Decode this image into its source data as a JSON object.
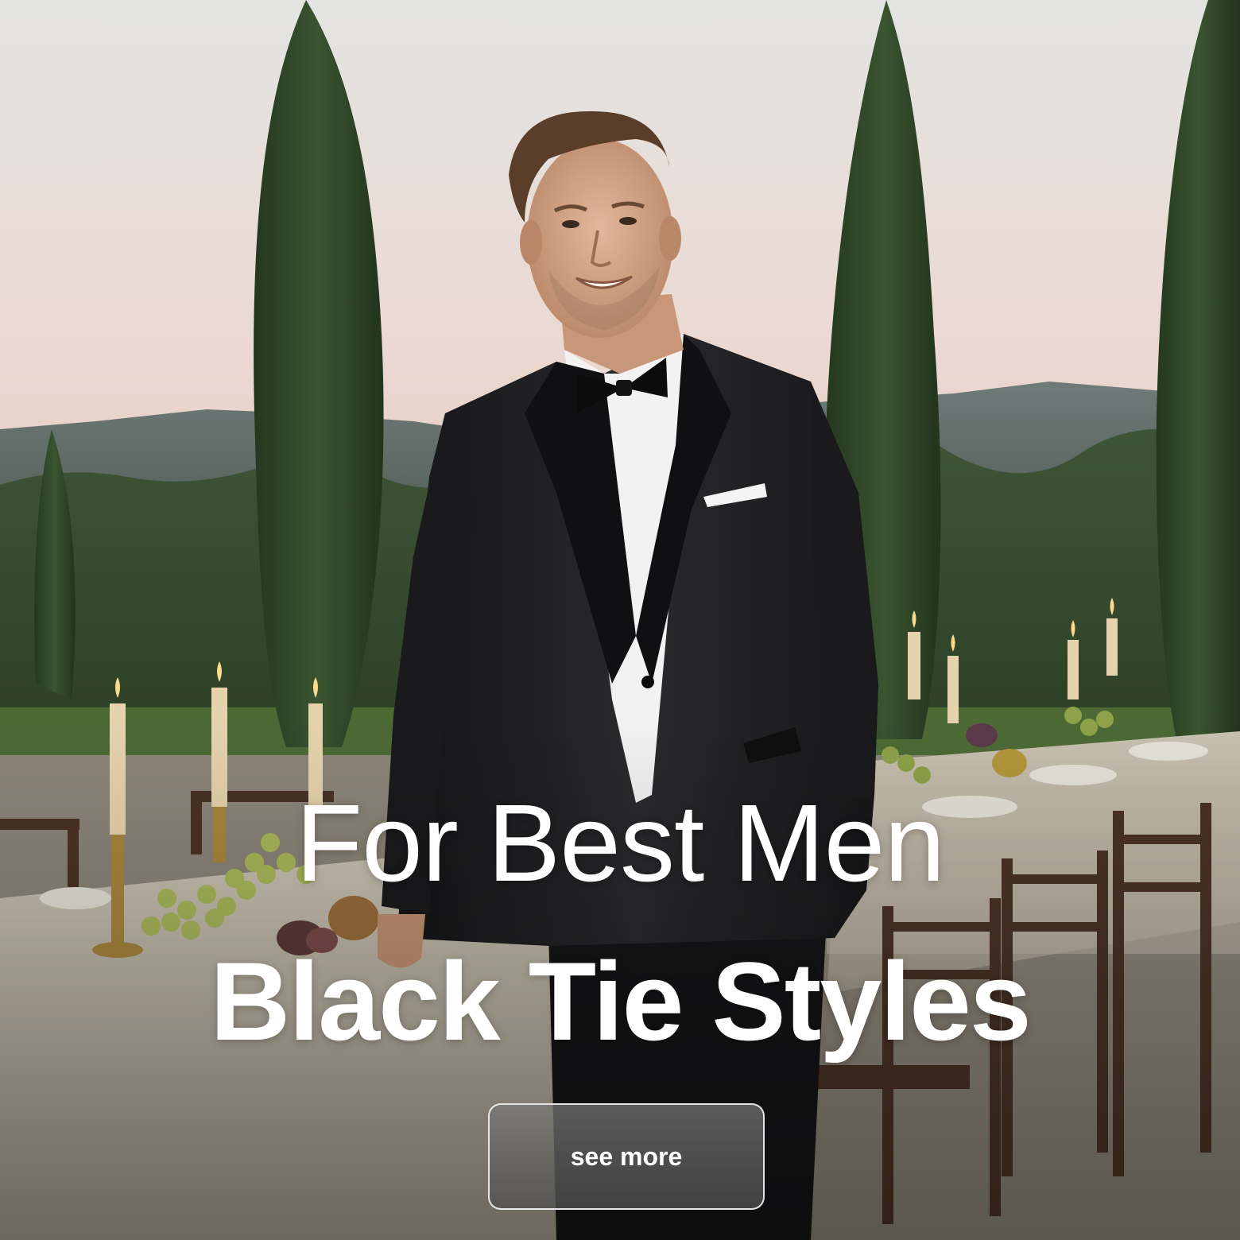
{
  "hero": {
    "line1": "For Best Men",
    "line2": "Black Tie Styles",
    "cta_label": "see more"
  },
  "colors": {
    "text": "#ffffff",
    "button_bg": "#6e6e6e",
    "suit": "#1c1c1e",
    "sky_top": "#e4e4e4",
    "sky_bottom": "#e9d6cf"
  },
  "image": {
    "subject": "man in black tuxedo with bow tie",
    "setting": "outdoor dinner table with candles, grapes and cypress trees at dusk"
  }
}
